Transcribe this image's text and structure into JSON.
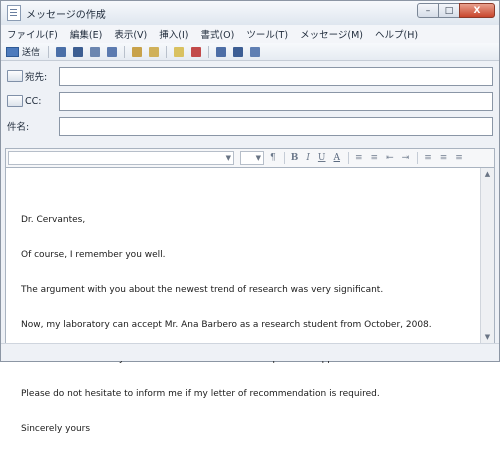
{
  "window": {
    "title": "メッセージの作成",
    "controls": {
      "minimize": "–",
      "maximize": "□",
      "close": "X"
    }
  },
  "menu": {
    "items": [
      "ファイル(F)",
      "編集(E)",
      "表示(V)",
      "挿入(I)",
      "書式(O)",
      "ツール(T)",
      "メッセージ(M)",
      "ヘルプ(H)"
    ]
  },
  "toolbar": {
    "send_label": "送信",
    "icons": [
      "cut-icon",
      "copy-icon",
      "paste-icon",
      "undo-icon",
      "check-names-icon",
      "spelling-icon",
      "attach-icon",
      "priority-icon",
      "sign-icon",
      "encrypt-icon",
      "offline-icon"
    ]
  },
  "headers": {
    "to_label": "宛先:",
    "cc_label": "CC:",
    "subject_label": "件名:",
    "to_value": "",
    "cc_value": "",
    "subject_value": ""
  },
  "format": {
    "font_value": "",
    "size_value": "",
    "buttons": [
      "B",
      "I",
      "U",
      "A",
      "≡",
      "≡",
      "⇤",
      "⇥",
      "≡",
      "≡",
      "≡"
    ]
  },
  "message": {
    "lines": [
      "Dr. Cervantes,",
      "Of course, I remember you well.",
      "The argument with you about the newest trend of research was very significant.",
      "Now, my laboratory can accept Mr. Ana Barbero as a research student from October, 2008.",
      "Please ask a university secretariat about documents required for application.",
      "Please do not hesitate to inform me if my letter of recommendation is required.",
      "Sincerely yours"
    ]
  },
  "colors": {
    "title_bg": "#dfe6ef",
    "close_red": "#c8452c",
    "send_blue": "#4d7bbd"
  }
}
